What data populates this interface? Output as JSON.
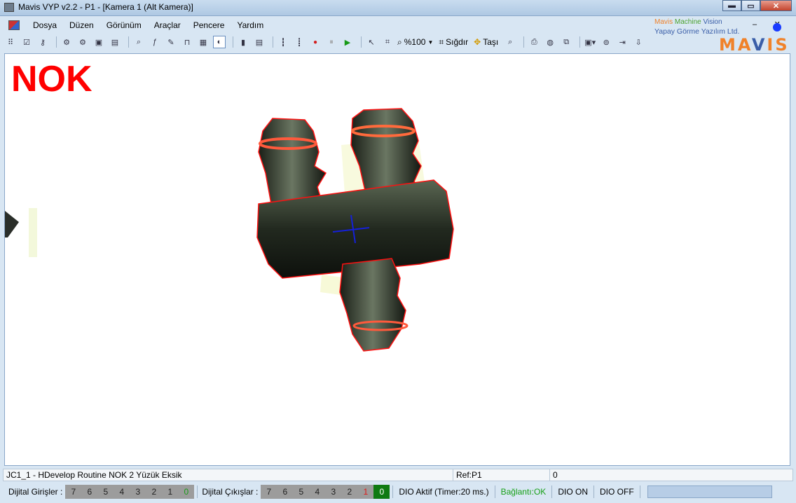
{
  "window": {
    "title": "Mavis VYP v2.2 - P1 - [Kamera 1 (Alt Kamera)]",
    "controls": {
      "minimize": "▬",
      "maximize": "▭",
      "close": "✕"
    }
  },
  "menu": {
    "items": [
      "Dosya",
      "Düzen",
      "Görünüm",
      "Araçlar",
      "Pencere",
      "Yardım"
    ]
  },
  "toolbar": {
    "zoom_label": "%100",
    "fit_label": "Sığdır",
    "move_label": "Taşı"
  },
  "brand": {
    "line1_a": "Mavis",
    "line1_b": "Machine",
    "line1_c": "Vision",
    "line2": "Yapay Görme Yazılım Ltd.",
    "logo_a": "MA",
    "logo_b": "V",
    "logo_c": "IS"
  },
  "image_view": {
    "result": "NOK",
    "result_color": "#ff0000"
  },
  "status": {
    "routine": "JC1_1 - HDevelop Routine NOK 2 Yüzük Eksik",
    "ref": "Ref:P1",
    "count": "0"
  },
  "dio": {
    "inputs_label": "Dijital Girişler :",
    "inputs": [
      {
        "label": "7",
        "state": "off"
      },
      {
        "label": "6",
        "state": "off"
      },
      {
        "label": "5",
        "state": "off"
      },
      {
        "label": "4",
        "state": "off"
      },
      {
        "label": "3",
        "state": "off"
      },
      {
        "label": "2",
        "state": "off"
      },
      {
        "label": "1",
        "state": "off"
      },
      {
        "label": "0",
        "state": "green"
      }
    ],
    "outputs_label": "Dijital Çıkışlar :",
    "outputs": [
      {
        "label": "7",
        "state": "off"
      },
      {
        "label": "6",
        "state": "off"
      },
      {
        "label": "5",
        "state": "off"
      },
      {
        "label": "4",
        "state": "off"
      },
      {
        "label": "3",
        "state": "off"
      },
      {
        "label": "2",
        "state": "off"
      },
      {
        "label": "1",
        "state": "red"
      },
      {
        "label": "0",
        "state": "on"
      }
    ],
    "active_text": "DIO Aktif (Timer:20 ms.)",
    "connection_text": "Bağlantı:OK",
    "on_label": "DIO ON",
    "off_label": "DIO OFF"
  }
}
